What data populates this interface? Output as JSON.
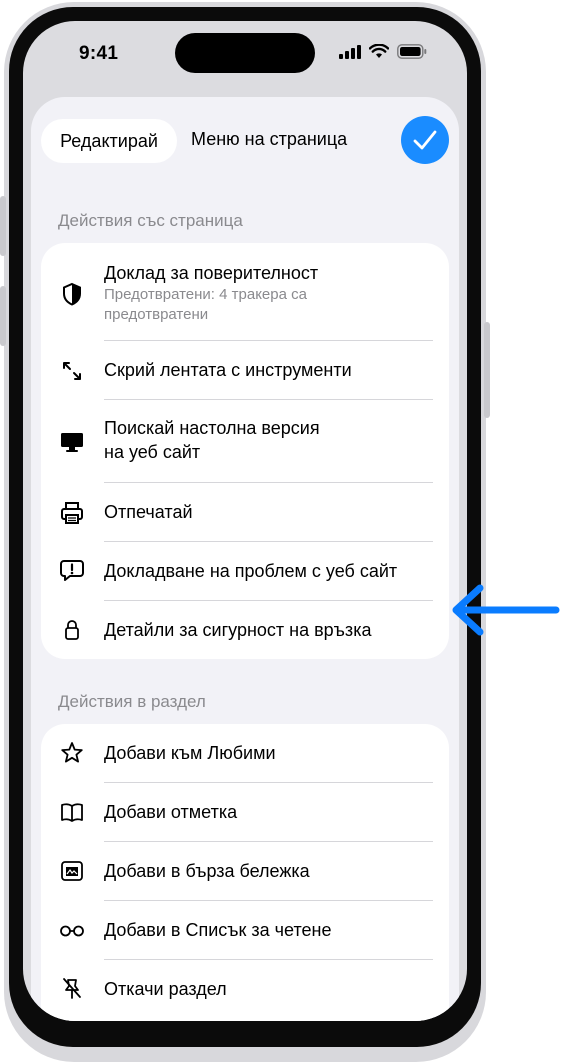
{
  "status_bar": {
    "time": "9:41"
  },
  "header": {
    "edit_label": "Редактирай",
    "title": "Меню на страница",
    "done_icon": "checkmark-icon"
  },
  "page_actions": {
    "heading": "Действия със страница",
    "items": [
      {
        "label": "Доклад за поверителност",
        "sublabel": "Предотвратени: 4 тракера са предотвратени",
        "icon": "privacy-shield-icon"
      },
      {
        "label": "Скрий лентата с инструменти",
        "icon": "expand-arrows-icon"
      },
      {
        "label": "Поискай настолна версия",
        "label2": "на уеб сайт",
        "icon": "desktop-icon"
      },
      {
        "label": "Отпечатай",
        "icon": "printer-icon"
      },
      {
        "label": "Докладване на проблем с уеб сайт",
        "icon": "report-bubble-icon"
      },
      {
        "label": "Детайли за сигурност на връзка",
        "icon": "lock-icon"
      }
    ]
  },
  "tab_actions": {
    "heading": "Действия в раздел",
    "items": [
      {
        "label": "Добави към Любими",
        "icon": "star-icon"
      },
      {
        "label": "Добави отметка",
        "icon": "book-icon"
      },
      {
        "label": "Добави в бърза бележка",
        "icon": "quick-note-icon"
      },
      {
        "label": "Добави в Списък за четене",
        "icon": "glasses-icon"
      },
      {
        "label": "Откачи раздел",
        "icon": "unpin-icon"
      }
    ]
  },
  "colors": {
    "accent": "#1a8cff",
    "callout_arrow": "#0a7cff"
  }
}
